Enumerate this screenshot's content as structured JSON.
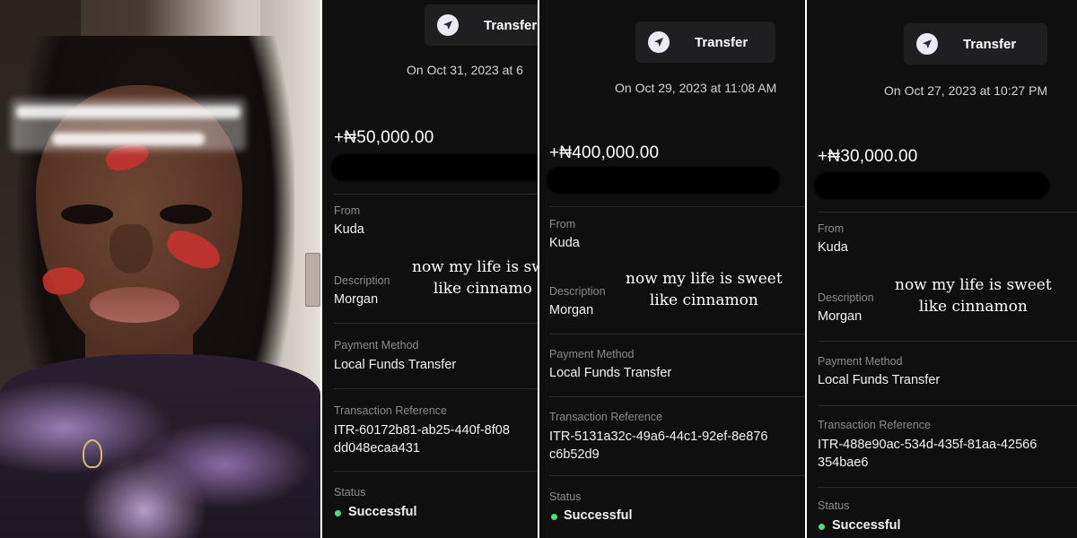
{
  "panels": [
    {
      "header_label": "Transfer",
      "icon": "send-arrow-icon",
      "date": "On Oct 31, 2023 at 6",
      "amount": "+₦50,000.00",
      "overlay_line1": "now my life is swe",
      "overlay_line2": "like cinnamo",
      "from_label": "From",
      "from_value": "Kuda",
      "description_label": "Description",
      "description_value": "Morgan",
      "payment_method_label": "Payment Method",
      "payment_method_value": "Local Funds Transfer",
      "reference_label": "Transaction Reference",
      "reference_line1": "ITR-60172b81-ab25-440f-8f08",
      "reference_line2": "dd048ecaa431",
      "status_label": "Status",
      "status_value": "Successful"
    },
    {
      "header_label": "Transfer",
      "icon": "send-arrow-icon",
      "date": "On Oct 29, 2023 at 11:08 AM",
      "amount": "+₦400,000.00",
      "overlay_line1": "now my life is sweet",
      "overlay_line2": "like cinnamon",
      "from_label": "From",
      "from_value": "Kuda",
      "description_label": "Description",
      "description_value": "Morgan",
      "payment_method_label": "Payment Method",
      "payment_method_value": "Local Funds Transfer",
      "reference_label": "Transaction Reference",
      "reference_line1": "ITR-5131a32c-49a6-44c1-92ef-8e876",
      "reference_line2": "c6b52d9",
      "status_label": "Status",
      "status_value": "Successful"
    },
    {
      "header_label": "Transfer",
      "icon": "send-arrow-icon",
      "date": "On Oct 27, 2023 at 10:27 PM",
      "amount": "+₦30,000.00",
      "overlay_line1": "now my life is sweet",
      "overlay_line2": "like cinnamon",
      "from_label": "From",
      "from_value": "Kuda",
      "description_label": "Description",
      "description_value": "Morgan",
      "payment_method_label": "Payment Method",
      "payment_method_value": "Local Funds Transfer",
      "reference_label": "Transaction Reference",
      "reference_line1": "ITR-488e90ac-534d-435f-81aa-42566",
      "reference_line2": "354bae6",
      "status_label": "Status",
      "status_value": "Successful"
    }
  ],
  "colors": {
    "panel_bg": "#0f0f10",
    "pill_bg": "#1f1f21",
    "status_green": "#4ade80",
    "label_gray": "#8b8b90"
  }
}
